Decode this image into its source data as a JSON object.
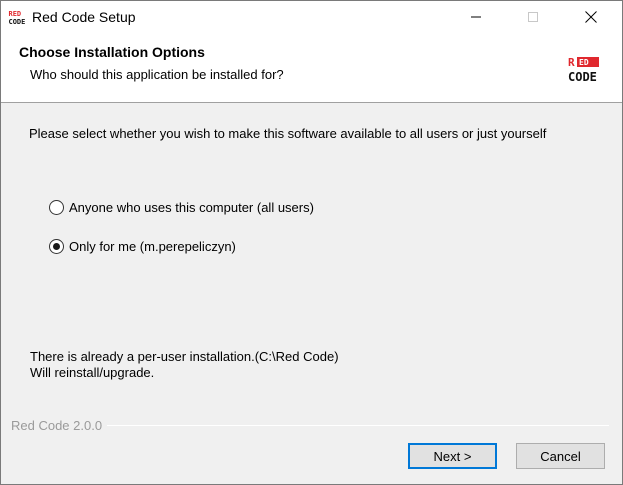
{
  "window": {
    "title": "Red Code Setup",
    "app_icon": "red-code-icon",
    "controls": [
      "minimize-icon",
      "maximize-icon",
      "close-icon"
    ]
  },
  "header": {
    "title": "Choose Installation Options",
    "subtitle": "Who should this application be installed for?",
    "logo": "red-code-logo"
  },
  "body": {
    "instruction": "Please select whether you wish to make this software available to all users or just yourself",
    "options": [
      {
        "label": "Anyone who uses this computer (all users)",
        "selected": false
      },
      {
        "label": "Only for me (m.perepeliczyn)",
        "selected": true
      }
    ],
    "notice_line1": "There is already a per-user installation.(C:\\Red Code)",
    "notice_line2": "Will reinstall/upgrade."
  },
  "footer": {
    "version": "Red Code 2.0.0",
    "next_label": "Next >",
    "cancel_label": "Cancel"
  },
  "colors": {
    "brand_red": "#e0282e",
    "focus_blue": "#0078d7"
  }
}
